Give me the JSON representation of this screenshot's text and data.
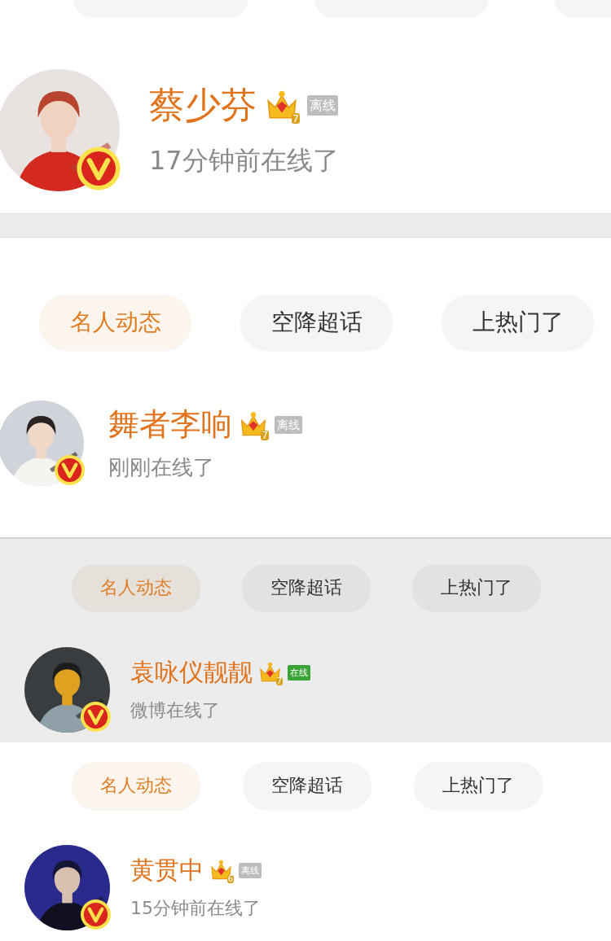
{
  "panels": [
    {
      "shaded": false,
      "profile": {
        "name": "蔡少芬",
        "vip_level": "7",
        "status_badge": {
          "label": "离线",
          "online": false
        },
        "last_seen": "17分钟前在线了"
      }
    },
    {
      "shaded": false,
      "tabs": [
        {
          "label": "名人动态",
          "selected": true
        },
        {
          "label": "空降超话",
          "selected": false
        },
        {
          "label": "上热门了",
          "selected": false
        }
      ],
      "profile": {
        "name": "舞者李响",
        "vip_level": "7",
        "status_badge": {
          "label": "离线",
          "online": false
        },
        "last_seen": "刚刚在线了"
      }
    },
    {
      "shaded": true,
      "tabs": [
        {
          "label": "名人动态",
          "selected": true
        },
        {
          "label": "空降超话",
          "selected": false
        },
        {
          "label": "上热门了",
          "selected": false
        }
      ],
      "profile": {
        "name": "袁咏仪靓靓",
        "vip_level": "7",
        "status_badge": {
          "label": "在线",
          "online": true
        },
        "last_seen": "微博在线了"
      }
    },
    {
      "shaded": false,
      "tabs": [
        {
          "label": "名人动态",
          "selected": true
        },
        {
          "label": "空降超话",
          "selected": false
        },
        {
          "label": "上热门了",
          "selected": false
        }
      ],
      "profile": {
        "name": "黄贯中",
        "vip_level": "6",
        "status_badge": {
          "label": "离线",
          "online": false
        },
        "last_seen": "15分钟前在线了"
      }
    }
  ]
}
